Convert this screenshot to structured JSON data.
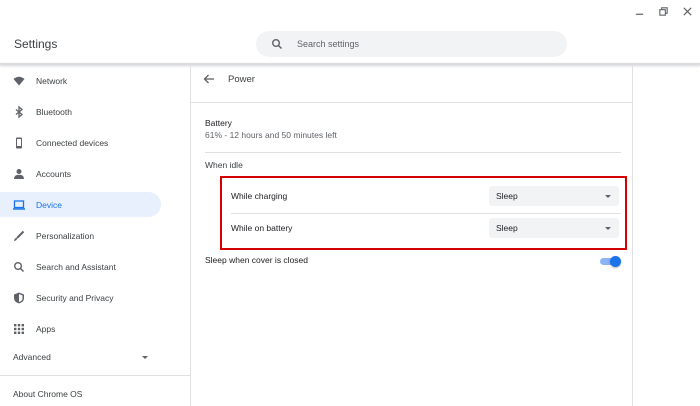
{
  "window": {
    "controls": [
      "minimize-icon",
      "restore-icon",
      "close-icon"
    ]
  },
  "header": {
    "title": "Settings",
    "search": {
      "placeholder": "Search settings",
      "icon": "search-icon"
    }
  },
  "sidebar": {
    "items": [
      {
        "label": "Network",
        "icon": "wifi-icon",
        "active": false
      },
      {
        "label": "Bluetooth",
        "icon": "bluetooth-icon",
        "active": false
      },
      {
        "label": "Connected devices",
        "icon": "phone-icon",
        "active": false
      },
      {
        "label": "Accounts",
        "icon": "person-icon",
        "active": false
      },
      {
        "label": "Device",
        "icon": "laptop-icon",
        "active": true
      },
      {
        "label": "Personalization",
        "icon": "brush-icon",
        "active": false
      },
      {
        "label": "Search and Assistant",
        "icon": "search-icon",
        "active": false
      },
      {
        "label": "Security and Privacy",
        "icon": "shield-icon",
        "active": false
      },
      {
        "label": "Apps",
        "icon": "apps-grid-icon",
        "active": false
      }
    ],
    "advanced": "Advanced",
    "about": "About Chrome OS"
  },
  "main": {
    "title": "Power",
    "battery": {
      "label": "Battery",
      "status": "61% - 12 hours and 50 minutes left"
    },
    "idle": {
      "label": "When idle",
      "rows": [
        {
          "label": "While charging",
          "value": "Sleep"
        },
        {
          "label": "While on battery",
          "value": "Sleep"
        }
      ]
    },
    "cover": {
      "label": "Sleep when cover is closed",
      "enabled": true
    }
  },
  "colors": {
    "accent": "#1a73e8",
    "active_bg": "#e8f0fe",
    "highlight_border": "#d50000"
  }
}
